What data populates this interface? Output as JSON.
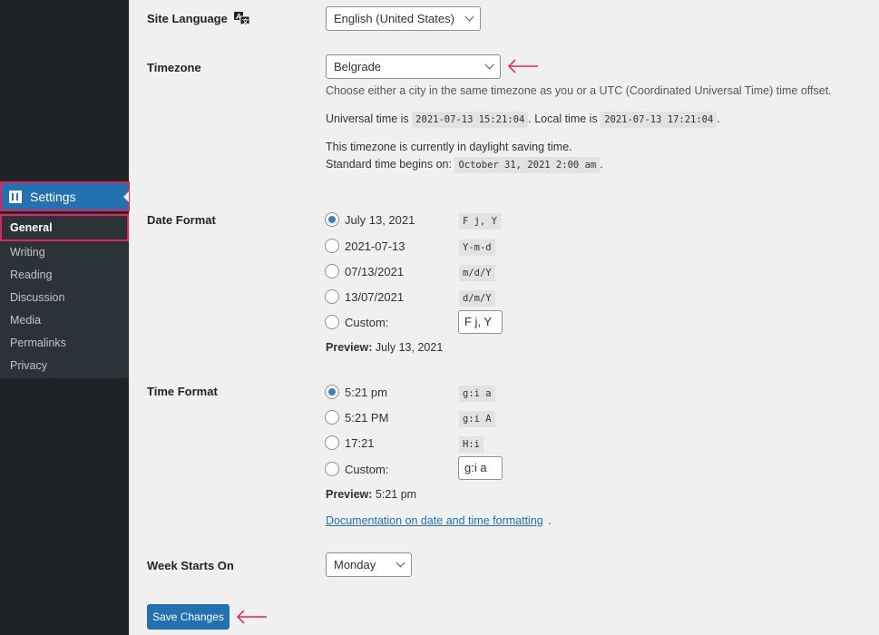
{
  "sidebar": {
    "menu_label": "Settings",
    "menu_icon": "settings-sliders-icon",
    "submenu": [
      {
        "label": "General",
        "current": true
      },
      {
        "label": "Writing"
      },
      {
        "label": "Reading"
      },
      {
        "label": "Discussion"
      },
      {
        "label": "Media"
      },
      {
        "label": "Permalinks"
      },
      {
        "label": "Privacy"
      }
    ]
  },
  "site_language": {
    "label": "Site Language",
    "icon": "translation-icon",
    "value": "English (United States)"
  },
  "timezone": {
    "label": "Timezone",
    "value": "Belgrade",
    "description": "Choose either a city in the same timezone as you or a UTC (Coordinated Universal Time) time offset.",
    "universal_prefix": "Universal time is",
    "universal_time": "2021-07-13 15:21:04",
    "local_prefix": ". Local time is",
    "local_time": "2021-07-13 17:21:04",
    "suffix": ".",
    "dst_note": "This timezone is currently in daylight saving time.",
    "standard_prefix": "Standard time begins on:",
    "standard_time": "October 31, 2021 2:00 am",
    "standard_suffix": "."
  },
  "date_format": {
    "label": "Date Format",
    "options": [
      {
        "label": "July 13, 2021",
        "code": "F j, Y",
        "checked": true
      },
      {
        "label": "2021-07-13",
        "code": "Y-m-d"
      },
      {
        "label": "07/13/2021",
        "code": "m/d/Y"
      },
      {
        "label": "13/07/2021",
        "code": "d/m/Y"
      },
      {
        "label": "Custom:",
        "input_value": "F j, Y"
      }
    ],
    "preview_label": "Preview:",
    "preview_value": "July 13, 2021"
  },
  "time_format": {
    "label": "Time Format",
    "options": [
      {
        "label": "5:21 pm",
        "code": "g:i a",
        "checked": true
      },
      {
        "label": "5:21 PM",
        "code": "g:i A"
      },
      {
        "label": "17:21",
        "code": "H:i"
      },
      {
        "label": "Custom:",
        "input_value": "g:i a"
      }
    ],
    "preview_label": "Preview:",
    "preview_value": "5:21 pm",
    "doc_link": "Documentation on date and time formatting",
    "doc_suffix": "."
  },
  "week_starts": {
    "label": "Week Starts On",
    "value": "Monday"
  },
  "save_button": "Save Changes",
  "colors": {
    "accent": "#2271b1",
    "highlight": "#e0245e",
    "sidebar": "#1d2327"
  }
}
